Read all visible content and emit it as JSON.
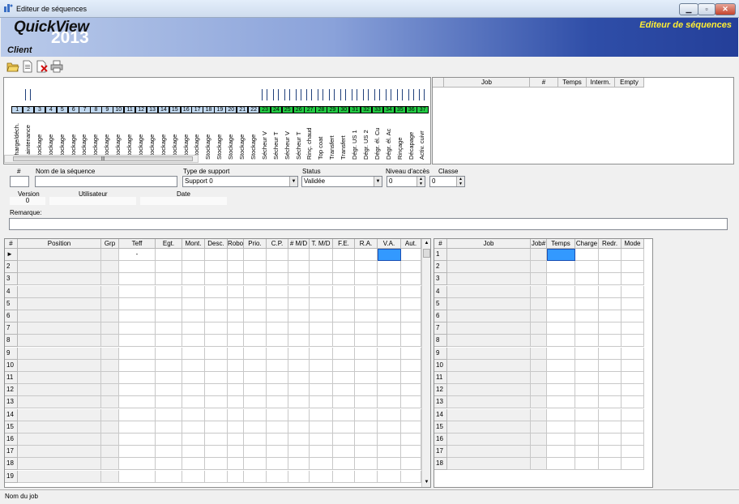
{
  "window": {
    "title": "Editeur de séquences"
  },
  "banner": {
    "product": "QuickView",
    "year": "2013",
    "client": "Client",
    "app_title": "Editeur de séquences"
  },
  "toolbar": {
    "icons": [
      "open-folder-icon",
      "new-document-icon",
      "delete-document-icon",
      "print-icon"
    ]
  },
  "stations": [
    {
      "num": "1",
      "name": "Charge/déch.",
      "active": false
    },
    {
      "num": "2",
      "name": "Maintenance",
      "active": false
    },
    {
      "num": "3",
      "name": "Stockage",
      "active": false
    },
    {
      "num": "4",
      "name": "Stockage",
      "active": false
    },
    {
      "num": "5",
      "name": "Stockage",
      "active": false
    },
    {
      "num": "6",
      "name": "Stockage",
      "active": false
    },
    {
      "num": "7",
      "name": "Stockage",
      "active": false
    },
    {
      "num": "8",
      "name": "Stockage",
      "active": false
    },
    {
      "num": "9",
      "name": "Stockage",
      "active": false
    },
    {
      "num": "10",
      "name": "Stockage",
      "active": false
    },
    {
      "num": "11",
      "name": "Stockage",
      "active": false
    },
    {
      "num": "12",
      "name": "Stockage",
      "active": false
    },
    {
      "num": "13",
      "name": "Stockage",
      "active": false
    },
    {
      "num": "14",
      "name": "Stockage",
      "active": false
    },
    {
      "num": "15",
      "name": "Stockage",
      "active": false
    },
    {
      "num": "16",
      "name": "Stockage",
      "active": false
    },
    {
      "num": "17",
      "name": "Stockage",
      "active": false
    },
    {
      "num": "18",
      "name": "Stockage",
      "active": false
    },
    {
      "num": "19",
      "name": "Stockage",
      "active": false
    },
    {
      "num": "20",
      "name": "Stockage",
      "active": false
    },
    {
      "num": "21",
      "name": "Stockage",
      "active": false
    },
    {
      "num": "22",
      "name": "Stockage",
      "active": false
    },
    {
      "num": "23",
      "name": "Sécheur V",
      "active": true
    },
    {
      "num": "24",
      "name": "Sécheur T",
      "active": true
    },
    {
      "num": "25",
      "name": "Sécheur V",
      "active": true
    },
    {
      "num": "26",
      "name": "Sécheur T",
      "active": true
    },
    {
      "num": "27",
      "name": "Rinç. chaud",
      "active": true
    },
    {
      "num": "28",
      "name": "Top coat",
      "active": true
    },
    {
      "num": "29",
      "name": "Transfert",
      "active": true
    },
    {
      "num": "30",
      "name": "Transfert",
      "active": true
    },
    {
      "num": "31",
      "name": "Dégr. US 1",
      "active": true
    },
    {
      "num": "32",
      "name": "Dégr. US 2",
      "active": true
    },
    {
      "num": "33",
      "name": "Dégr. él. Cu",
      "active": true
    },
    {
      "num": "34",
      "name": "Dégr. él. Ac",
      "active": true
    },
    {
      "num": "35",
      "name": "Rinçage",
      "active": true
    },
    {
      "num": "36",
      "name": "Décapage",
      "active": true
    },
    {
      "num": "37",
      "name": "Activ. cuivr",
      "active": true
    }
  ],
  "job_panel": {
    "columns": [
      "Job",
      "#",
      "Temps",
      "Interm.",
      "Empty"
    ]
  },
  "form": {
    "num_label": "#",
    "name_label": "Nom de la séquence",
    "support_label": "Type de support",
    "support_value": "Support 0",
    "status_label": "Status",
    "status_value": "Validée",
    "access_label": "Niveau d'accès",
    "access_value": "0",
    "classe_label": "Classe",
    "classe_value": "0",
    "version_label": "Version",
    "version_value": "0",
    "user_label": "Utilisateur",
    "date_label": "Date",
    "remark_label": "Remarque:"
  },
  "seq_grid": {
    "columns": [
      "#",
      "Position",
      "Grp",
      "Teff",
      "Egt.",
      "Mont.",
      "Desc.",
      "Robot",
      "Prio.",
      "C.P.",
      "# M/D",
      "T. M/D",
      "F.E.",
      "R.A.",
      "V.A.",
      "Aut."
    ],
    "current_marker": "►",
    "first_row_teff": "-",
    "rows": [
      "",
      "2",
      "3",
      "4",
      "5",
      "6",
      "7",
      "8",
      "9",
      "10",
      "11",
      "12",
      "13",
      "14",
      "15",
      "16",
      "17",
      "18",
      "19"
    ]
  },
  "job_grid": {
    "columns": [
      "#",
      "Job",
      "Job#",
      "Temps",
      "Charge",
      "Redr.",
      "Mode"
    ],
    "rows": [
      "1",
      "2",
      "3",
      "4",
      "5",
      "6",
      "7",
      "8",
      "9",
      "10",
      "11",
      "12",
      "13",
      "14",
      "15",
      "16",
      "17",
      "18"
    ]
  },
  "status": {
    "text": "Nom du job"
  },
  "colors": {
    "station_active": "#22cc44",
    "station_inactive": "#c0d8f0",
    "selection": "#3399ff",
    "banner_title": "#ffee33"
  }
}
